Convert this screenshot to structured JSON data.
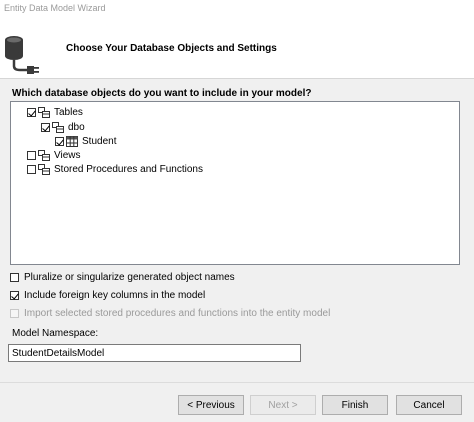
{
  "window": {
    "title": "Entity Data Model Wizard"
  },
  "header": {
    "subtitle": "Choose Your Database Objects and Settings",
    "icon": "database-connect-icon"
  },
  "tree": {
    "question": "Which database objects do you want to include in your model?",
    "tables_label": "Tables",
    "schema_label": "dbo",
    "table_label": "Student",
    "views_label": "Views",
    "procs_label": "Stored Procedures and Functions"
  },
  "options": {
    "pluralize_label": "Pluralize or singularize generated object names",
    "pluralize_checked": false,
    "foreign_keys_label": "Include foreign key columns in the model",
    "foreign_keys_checked": true,
    "import_procs_label": "Import selected stored procedures and functions into the entity model",
    "import_procs_checked": false
  },
  "namespace": {
    "label": "Model Namespace:",
    "value": "StudentDetailsModel"
  },
  "buttons": {
    "previous": "< Previous",
    "next": "Next >",
    "finish": "Finish",
    "cancel": "Cancel"
  },
  "colors": {
    "accent": "#f2a900",
    "dark_grey": "#3a3a3a"
  }
}
